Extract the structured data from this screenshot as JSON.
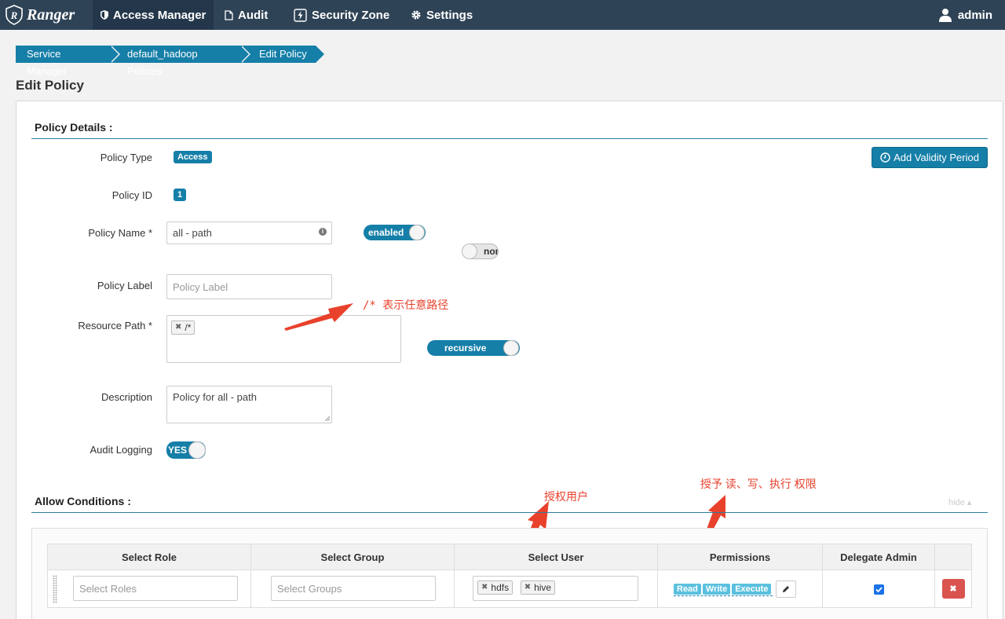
{
  "nav": {
    "brand": "Ranger",
    "items": [
      "Access Manager",
      "Audit",
      "Security Zone",
      "Settings"
    ],
    "user": "admin"
  },
  "breadcrumb": [
    "Service Manager",
    "default_hadoop Policies",
    "Edit Policy"
  ],
  "page_title": "Edit Policy",
  "policy_details": {
    "section_title": "Policy Details :",
    "policy_type_label": "Policy Type",
    "policy_type_value": "Access",
    "add_validity_label": "Add Validity Period",
    "policy_id_label": "Policy ID",
    "policy_id_value": "1",
    "policy_name_label": "Policy Name *",
    "policy_name_value": "all - path",
    "enabled_toggle": "enabled",
    "normal_toggle": "nor",
    "policy_label_label": "Policy Label",
    "policy_label_placeholder": "Policy Label",
    "resource_path_label": "Resource Path *",
    "resource_path_tag": "/*",
    "recursive_toggle": "recursive",
    "description_label": "Description",
    "description_value": "Policy for all - path",
    "audit_logging_label": "Audit Logging",
    "audit_logging_value": "YES"
  },
  "annotations": {
    "path_note": "/* 表示任意路径",
    "user_note": "授权用户",
    "perm_note": "授予 读、写、执行 权限"
  },
  "allow_conditions": {
    "section_title": "Allow Conditions :",
    "hide_label": "hide",
    "columns": [
      "Select Role",
      "Select Group",
      "Select User",
      "Permissions",
      "Delegate Admin"
    ],
    "roles_placeholder": "Select Roles",
    "groups_placeholder": "Select Groups",
    "users": [
      "hdfs",
      "hive"
    ],
    "permissions": [
      "Read",
      "Write",
      "Execute"
    ],
    "delegate_admin_checked": true
  },
  "colors": {
    "nav_bg": "#2f4356",
    "accent": "#157fa8",
    "annotation": "#e8412c",
    "delete": "#d9534f",
    "perm_tag": "#5bc0de"
  }
}
